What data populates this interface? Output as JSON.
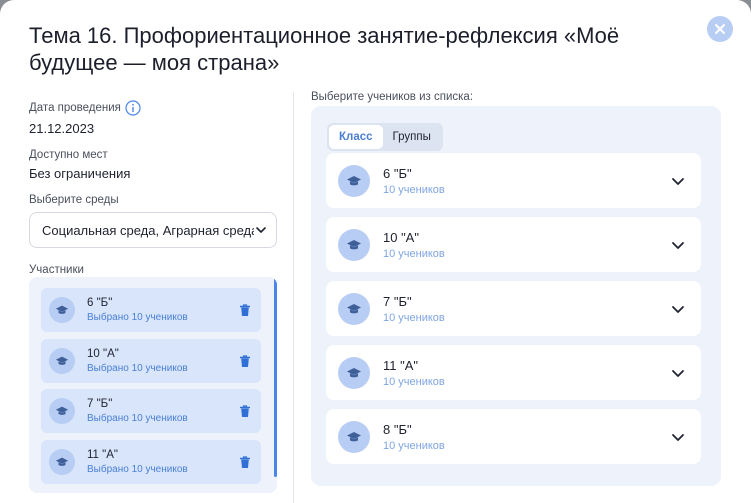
{
  "modal": {
    "title": "Тема 16. Профориентационное занятие-рефлексия «Моё будущее — моя страна»"
  },
  "details": {
    "date_label": "Дата проведения",
    "date_value": "21.12.2023",
    "seats_label": "Доступно мест",
    "seats_value": "Без ограничения",
    "env_label": "Выберите среды",
    "env_value": "Социальная среда, Аграрная среда"
  },
  "participants": {
    "label": "Участники",
    "items": [
      {
        "name": "6 \"Б\"",
        "sub": "Выбрано 10 учеников"
      },
      {
        "name": "10 \"А\"",
        "sub": "Выбрано 10 учеников"
      },
      {
        "name": "7 \"Б\"",
        "sub": "Выбрано 10 учеников"
      },
      {
        "name": "11 \"А\"",
        "sub": "Выбрано 10 учеников"
      }
    ]
  },
  "students": {
    "label": "Выберите учеников из списка:",
    "tabs": [
      {
        "label": "Класс",
        "active": true
      },
      {
        "label": "Группы",
        "active": false
      }
    ],
    "classes": [
      {
        "name": "6 \"Б\"",
        "sub": "10 учеников"
      },
      {
        "name": "10 \"А\"",
        "sub": "10 учеников"
      },
      {
        "name": "7 \"Б\"",
        "sub": "10 учеников"
      },
      {
        "name": "11 \"А\"",
        "sub": "10 учеников"
      },
      {
        "name": "8 \"Б\"",
        "sub": "10 учеников"
      }
    ]
  },
  "colors": {
    "accent": "#4a86e8",
    "panel_bg": "#eef2fb",
    "item_bg": "#d8e5fb",
    "avatar_bg": "#b7cdf3"
  },
  "icons": {
    "close": "close-icon",
    "info": "info-icon",
    "select_arrow": "chevron-down-icon",
    "avatar": "graduation-cap-icon",
    "delete": "trash-icon",
    "expand": "chevron-down-icon"
  }
}
